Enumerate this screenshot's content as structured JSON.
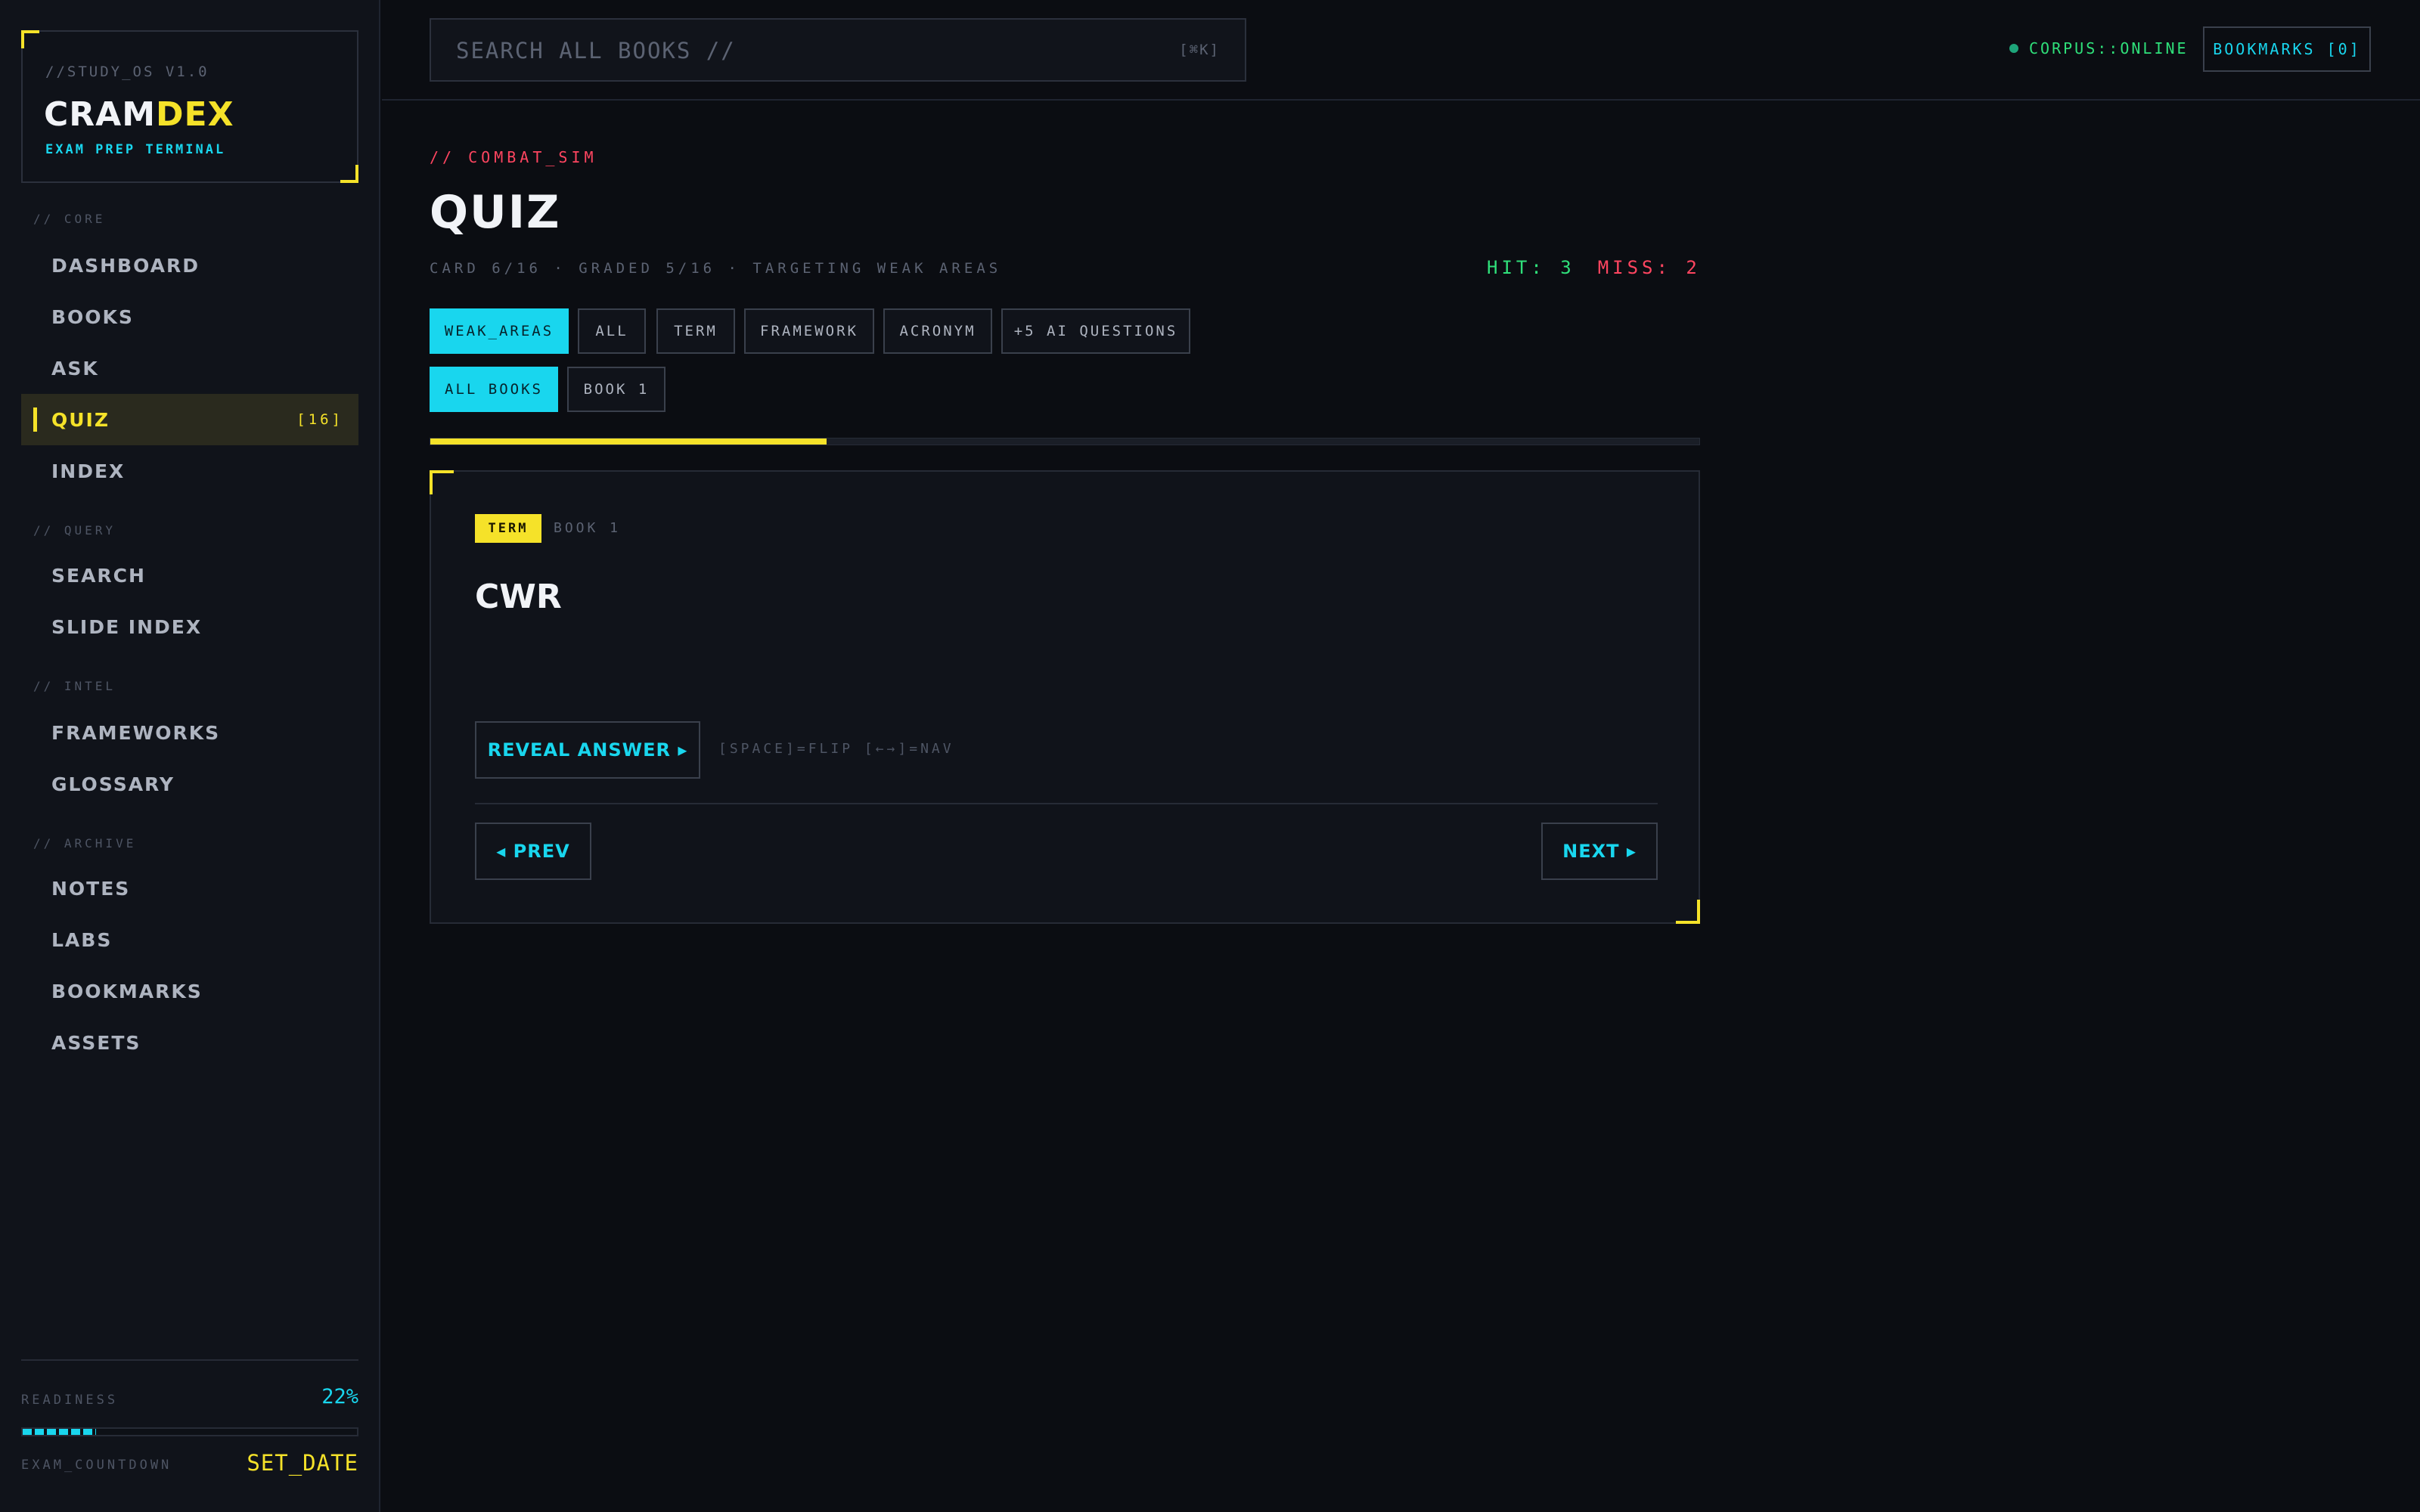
{
  "brand": {
    "version": "//STUDY_OS V1.0",
    "title_main": "CRAM",
    "title_accent": "DEX",
    "subtitle": "EXAM PREP TERMINAL"
  },
  "sidebar": {
    "sections": [
      {
        "label": "// CORE"
      },
      {
        "label": "// QUERY"
      },
      {
        "label": "// INTEL"
      },
      {
        "label": "// ARCHIVE"
      }
    ],
    "items": [
      {
        "label": "DASHBOARD"
      },
      {
        "label": "BOOKS"
      },
      {
        "label": "ASK"
      },
      {
        "label": "QUIZ",
        "count": "[16]",
        "active": true
      },
      {
        "label": "INDEX"
      },
      {
        "label": "SEARCH"
      },
      {
        "label": "SLIDE INDEX"
      },
      {
        "label": "FRAMEWORKS"
      },
      {
        "label": "GLOSSARY"
      },
      {
        "label": "NOTES"
      },
      {
        "label": "LABS"
      },
      {
        "label": "BOOKMARKS"
      },
      {
        "label": "ASSETS"
      }
    ],
    "footer": {
      "readiness_label": "READINESS",
      "readiness_value": "22%",
      "readiness_fraction": 0.22,
      "countdown_label": "EXAM_COUNTDOWN",
      "countdown_value": "SET_DATE"
    }
  },
  "topbar": {
    "search_placeholder": "SEARCH ALL BOOKS //",
    "search_shortcut": "[⌘K]",
    "status": "CORPUS::ONLINE",
    "bookmarks_label": "BOOKMARKS [0]"
  },
  "main": {
    "tag": "// COMBAT_SIM",
    "title": "QUIZ",
    "meta": "CARD 6/16 · GRADED 5/16 · TARGETING WEAK AREAS",
    "hit": "HIT: 3",
    "miss": "MISS: 2",
    "filters": [
      {
        "label": "WEAK_AREAS",
        "selected": true
      },
      {
        "label": "ALL"
      },
      {
        "label": "TERM"
      },
      {
        "label": "FRAMEWORK"
      },
      {
        "label": "ACRONYM"
      },
      {
        "label": "+5 AI QUESTIONS"
      }
    ],
    "books": [
      {
        "label": "ALL BOOKS",
        "selected": true
      },
      {
        "label": "BOOK 1"
      }
    ],
    "progress_fraction": 0.3125
  },
  "card": {
    "badge": "TERM",
    "book": "BOOK 1",
    "term": "CWR",
    "reveal_label": "REVEAL ANSWER ▸",
    "hint": "[SPACE]=FLIP [←→]=NAV",
    "prev_label": "◂ PREV",
    "next_label": "NEXT ▸"
  },
  "colors": {
    "background": "#0b0d12",
    "panel": "#10131a",
    "accent_yellow": "#f5e229",
    "accent_cyan": "#19d6ee",
    "hit_green": "#2fe07a",
    "miss_red": "#ff4560"
  }
}
